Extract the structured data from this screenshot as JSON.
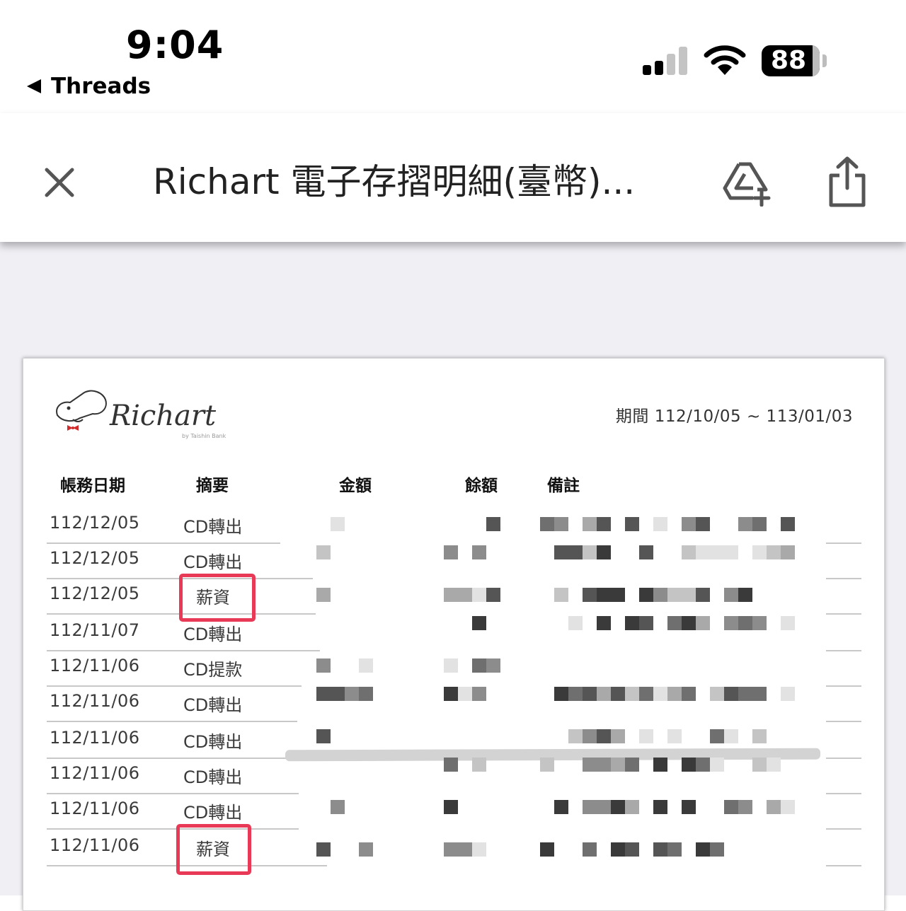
{
  "status_bar": {
    "time": "9:04",
    "back_app": "Threads",
    "battery": "88"
  },
  "toolbar": {
    "title": "Richart 電子存摺明細(臺幣)...",
    "icons": [
      "close-icon",
      "drive-add-icon",
      "share-icon"
    ]
  },
  "statement": {
    "logo_text": "Richart",
    "logo_sub": "by Taishin Bank",
    "period": "期間 112/10/05 ~ 113/01/03",
    "headers": {
      "date": "帳務日期",
      "summary": "摘要",
      "amount": "金額",
      "balance": "餘額",
      "note": "備註"
    },
    "rows": [
      {
        "date": "112/12/05",
        "summary": "CD轉出"
      },
      {
        "date": "112/12/05",
        "summary": "CD轉出"
      },
      {
        "date": "112/12/05",
        "summary": "薪資"
      },
      {
        "date": "112/11/07",
        "summary": "CD轉出"
      },
      {
        "date": "112/11/06",
        "summary": "CD提款"
      },
      {
        "date": "112/11/06",
        "summary": "CD轉出"
      },
      {
        "date": "112/11/06",
        "summary": "CD轉出"
      },
      {
        "date": "112/11/06",
        "summary": "CD轉出"
      },
      {
        "date": "112/11/06",
        "summary": "CD轉出"
      },
      {
        "date": "112/11/06",
        "summary": "薪資"
      }
    ],
    "highlight_color": "#e83a56",
    "amounts_redacted": true
  }
}
